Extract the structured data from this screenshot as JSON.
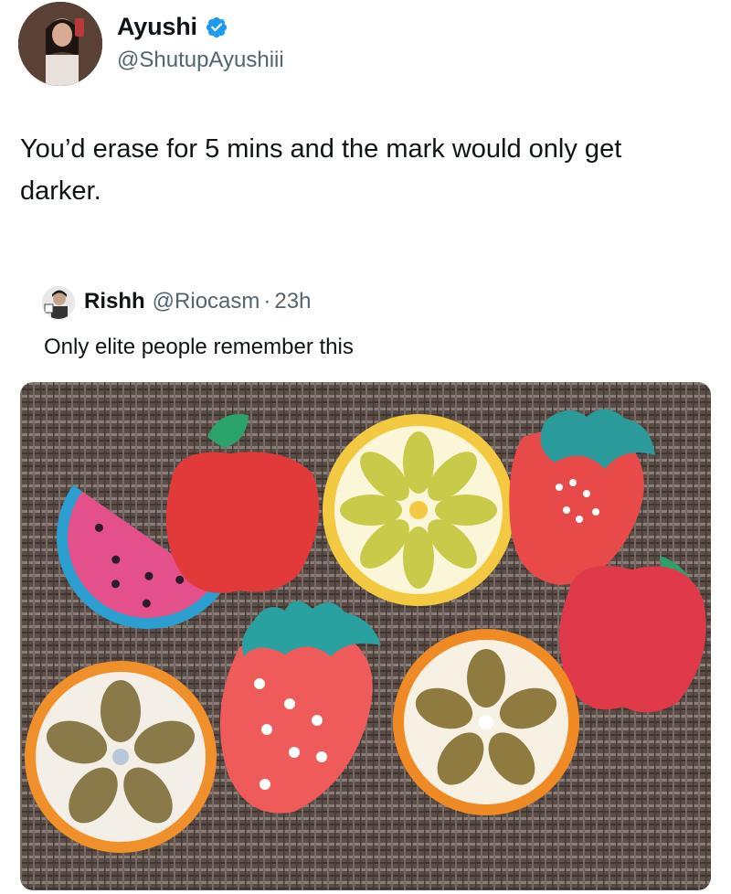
{
  "tweet": {
    "author_name": "Ayushi",
    "author_handle": "@ShutupAyushiii",
    "text": "You’d erase for 5 mins and the mark would only get darker.",
    "verified_icon": "verified-badge-icon",
    "accent_color": "#1d9bf0"
  },
  "quoted_tweet": {
    "author_name": "Rishh",
    "author_handle": "@Riocasm",
    "separator": "·",
    "time": "23h",
    "text": "Only elite people remember this"
  }
}
